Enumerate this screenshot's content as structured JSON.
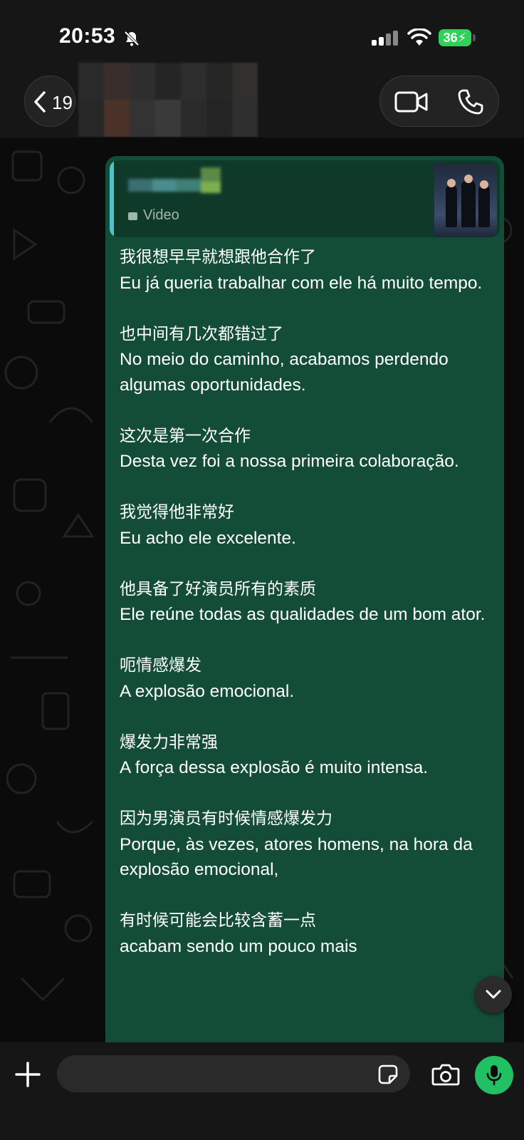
{
  "status_bar": {
    "time": "20:53",
    "battery": "36"
  },
  "header": {
    "back_count": "19",
    "icons": [
      "chevron-left-icon",
      "video-camera-icon",
      "phone-icon",
      "bell-slash-icon"
    ]
  },
  "message": {
    "quote_type": "Video",
    "lines": [
      {
        "zh": "我很想早早就想跟他合作了",
        "pt": "Eu já queria trabalhar com ele há muito tempo."
      },
      {
        "zh": "也中间有几次都错过了",
        "pt": "No meio do caminho, acabamos perdendo algumas oportunidades."
      },
      {
        "zh": "这次是第一次合作",
        "pt": "Desta vez foi a nossa primeira colaboração."
      },
      {
        "zh": "我觉得他非常好",
        "pt": "Eu acho ele excelente."
      },
      {
        "zh": "他具备了好演员所有的素质",
        "pt": "Ele reúne todas as qualidades de um bom ator."
      },
      {
        "zh": "呃情感爆发",
        "pt": "A explosão emocional."
      },
      {
        "zh": "爆发力非常强",
        "pt": "A força dessa explosão é muito intensa."
      },
      {
        "zh": "因为男演员有时候情感爆发力",
        "pt": "Porque, às vezes, atores homens, na hora da explosão emocional,"
      },
      {
        "zh": "有时候可能会比较含蓄一点",
        "pt": "acabam sendo um pouco mais"
      }
    ]
  },
  "colors": {
    "bubble": "#144d37",
    "quote_accent": "#4fc3c5",
    "mic": "#21c063",
    "battery": "#30d158"
  }
}
